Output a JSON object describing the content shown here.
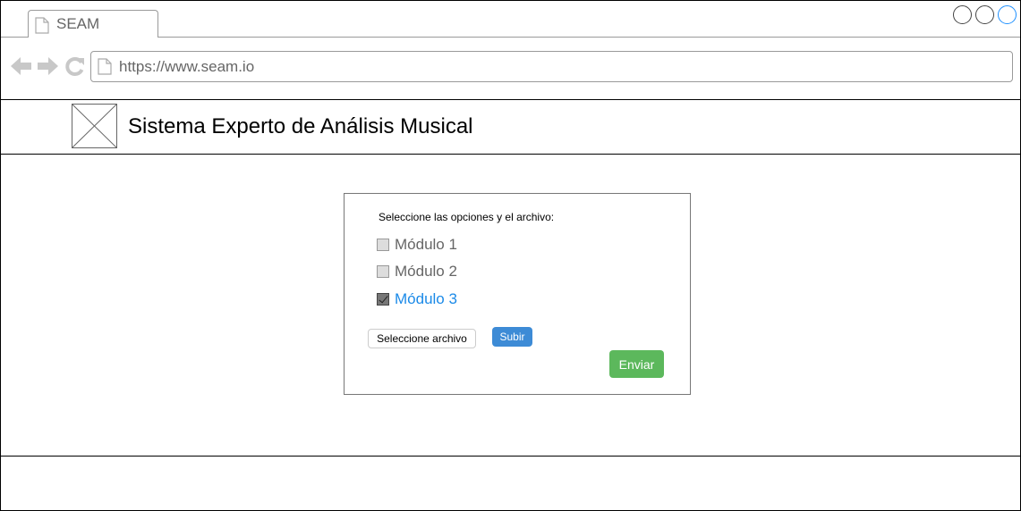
{
  "browser": {
    "tab_title": "SEAM",
    "url": "https://www.seam.io",
    "icons": [
      "page-icon",
      "back-arrow-icon",
      "forward-arrow-icon",
      "refresh-icon"
    ]
  },
  "header": {
    "title": "Sistema Experto de Análisis Musical",
    "logo": "image-placeholder-icon"
  },
  "form": {
    "prompt": "Seleccione las opciones y el archivo:",
    "options": [
      {
        "label": "Módulo 1",
        "checked": false
      },
      {
        "label": "Módulo 2",
        "checked": false
      },
      {
        "label": "Módulo 3",
        "checked": true
      }
    ],
    "file_button": "Seleccione archivo",
    "upload_button": "Subir",
    "submit_button": "Enviar"
  },
  "colors": {
    "selected_option": "#1b8ae8",
    "upload_button": "#3d8bd6",
    "submit_button": "#5cb85c",
    "active_window_control": "#1e90ff"
  }
}
